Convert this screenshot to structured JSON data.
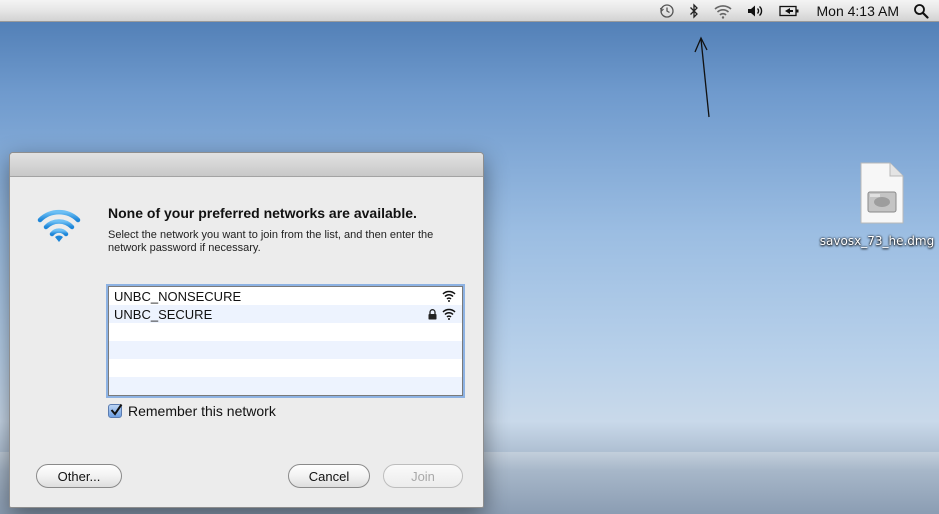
{
  "menubar": {
    "icons": [
      "time-machine-icon",
      "bluetooth-icon",
      "wifi-icon",
      "volume-icon",
      "battery-icon",
      "spotlight-icon"
    ],
    "clock": "Mon 4:13 AM"
  },
  "desktop": {
    "file_label": "savosx_73_he.dmg"
  },
  "dialog": {
    "heading": "None of your preferred networks are available.",
    "subtext": "Select the network you want to join from the list, and then enter the network password if necessary.",
    "networks": [
      {
        "name": "UNBC_NONSECURE",
        "locked": false
      },
      {
        "name": "UNBC_SECURE",
        "locked": true
      }
    ],
    "remember_label": "Remember this network",
    "remember_checked": true,
    "other_button": "Other...",
    "cancel_button": "Cancel",
    "join_button": "Join"
  }
}
